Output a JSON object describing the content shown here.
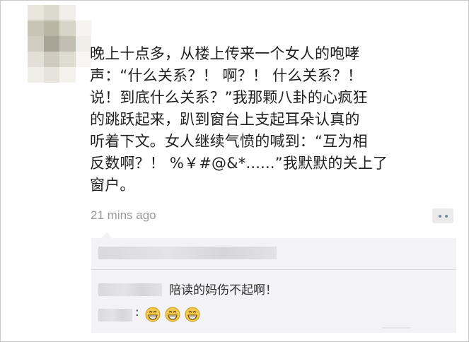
{
  "post": {
    "lines": [
      "晚上十点多，从楼上传来一个女人的咆哮",
      "声：“什么关系？！ 啊？！ 什么关系？！",
      "说！到底什么关系？”我那颗八卦的心疯狂",
      "的跳跃起来，趴到窗台上支起耳朵认真的",
      "听着下文。女人继续气愤的喊到：“互为相",
      "反数啊？！ %￥#@&*......”我默默的关上了",
      "窗户。"
    ],
    "timestamp": "21 mins ago",
    "action_icon": "comment-dots-icon"
  },
  "comments": [
    {
      "text": "陪读的妈伤不起啊！"
    },
    {
      "separator": ":",
      "emojis": [
        "grin-emoji",
        "grin-emoji",
        "grin-emoji"
      ]
    }
  ],
  "colors": {
    "text": "#1f1f1f",
    "timestamp": "#9a9a9a",
    "comment_bg": "#f3f3f5",
    "emoji_yellow": "#f2c94c"
  }
}
